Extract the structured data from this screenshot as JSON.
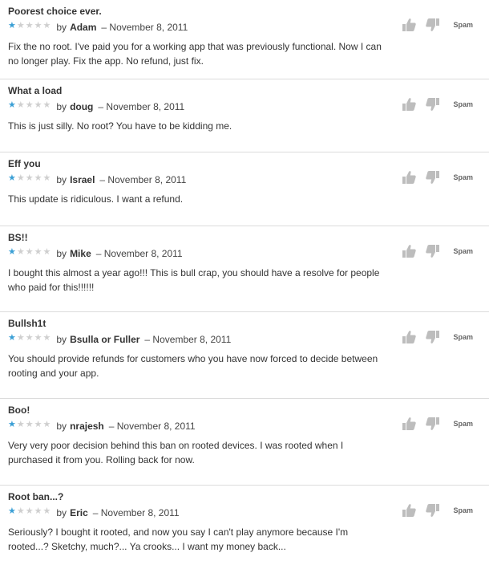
{
  "reviews": [
    {
      "title": "Poorest choice ever.",
      "rating": 1,
      "by": "by",
      "author": "Adam",
      "date": "– November 8, 2011",
      "body": "Fix the no root. I've paid you for a working app that was previously functional. Now I can no longer play. Fix the app. No refund, just fix.",
      "spam": "Spam"
    },
    {
      "title": "What a load",
      "rating": 1,
      "by": "by",
      "author": "doug",
      "date": "– November 8, 2011",
      "body": "This is just silly. No root? You have to be kidding me.",
      "spam": "Spam"
    },
    {
      "title": "Eff you",
      "rating": 1,
      "by": "by",
      "author": "Israel",
      "date": "– November 8, 2011",
      "body": "This update is ridiculous. I want a refund.",
      "spam": "Spam"
    },
    {
      "title": "BS!!",
      "rating": 1,
      "by": "by",
      "author": "Mike",
      "date": "– November 8, 2011",
      "body": "I bought this almost a year ago!!! This is bull crap, you should have a resolve for people who paid for this!!!!!!",
      "spam": "Spam"
    },
    {
      "title": "Bullsh1t",
      "rating": 1,
      "by": "by",
      "author": "Bsulla or Fuller",
      "date": "– November 8, 2011",
      "body": "You should provide refunds for customers who you have now forced to decide between rooting and your app.",
      "spam": "Spam"
    },
    {
      "title": "Boo!",
      "rating": 1,
      "by": "by",
      "author": "nrajesh",
      "date": "– November 8, 2011",
      "body": "Very very poor decision behind this ban on rooted devices. I was rooted when I purchased it from you. Rolling back for now.",
      "spam": "Spam"
    },
    {
      "title": "Root ban...?",
      "rating": 1,
      "by": "by",
      "author": "Eric",
      "date": "– November 8, 2011",
      "body": "Seriously? I bought it rooted, and now you say I can't play anymore because I'm rooted...? Sketchy, much?... Ya crooks... I want my money back...",
      "spam": "Spam"
    }
  ],
  "colors": {
    "star_on": "#3a9fd5",
    "star_off": "#cfcfcf",
    "divider": "#dcdcdc"
  },
  "icons": {
    "helpful": "thumbs-up-icon",
    "unhelpful": "thumbs-down-icon"
  }
}
